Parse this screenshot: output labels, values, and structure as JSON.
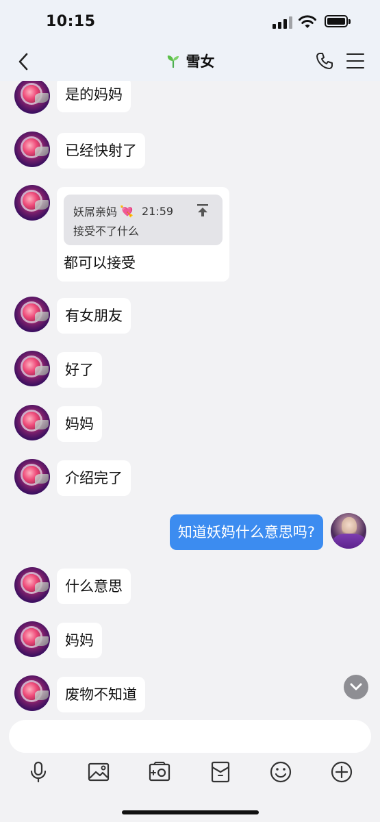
{
  "status_bar": {
    "time": "10:15"
  },
  "header": {
    "title": "雪女",
    "title_icon": "sprout-icon"
  },
  "messages": [
    {
      "side": "left",
      "text": "是的妈妈"
    },
    {
      "side": "left",
      "text": "已经快射了"
    },
    {
      "side": "left",
      "type": "reply",
      "quote": {
        "name": "妖屌亲妈",
        "emoji": "💘",
        "time": "21:59",
        "text": "接受不了什么"
      },
      "text": "都可以接受"
    },
    {
      "side": "left",
      "text": "有女朋友"
    },
    {
      "side": "left",
      "text": "好了"
    },
    {
      "side": "left",
      "text": "妈妈"
    },
    {
      "side": "left",
      "text": "介绍完了"
    },
    {
      "side": "right",
      "text": "知道妖妈什么意思吗?"
    },
    {
      "side": "left",
      "text": "什么意思"
    },
    {
      "side": "left",
      "text": "妈妈"
    },
    {
      "side": "left",
      "text": "废物不知道"
    }
  ],
  "input": {
    "placeholder": "",
    "value": ""
  },
  "toolbar": [
    "microphone-icon",
    "image-icon",
    "camera-icon",
    "red-packet-icon",
    "emoji-icon",
    "plus-icon"
  ],
  "colors": {
    "accent": "#3c8cf0",
    "background": "#f2f2f4",
    "bubble": "#ffffff"
  }
}
